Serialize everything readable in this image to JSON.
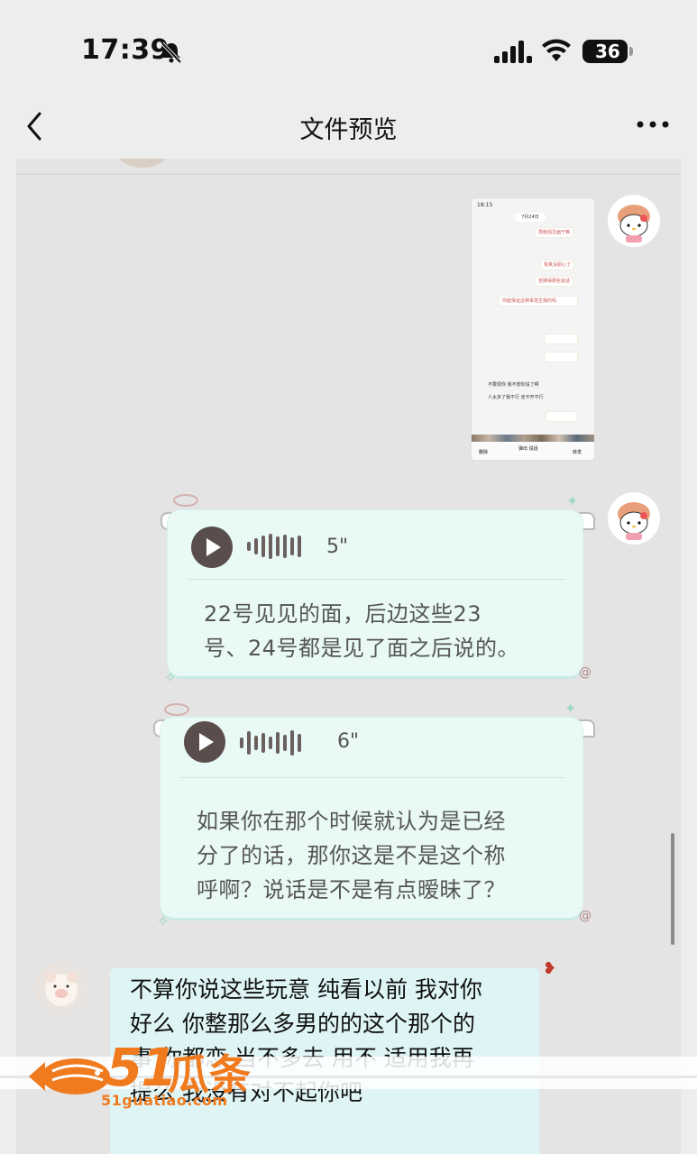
{
  "status_bar": {
    "time": "17:39",
    "battery": "36",
    "icons": [
      "bell-slash-icon",
      "signal-icon",
      "wifi-icon",
      "battery-icon"
    ]
  },
  "nav": {
    "title": "文件预览",
    "back_icon": "chevron-left-icon",
    "more_icon": "more-dots-icon"
  },
  "screenshot_thumbnail": {
    "time": "18:15",
    "date_pill": "7月24日",
    "lines": [
      "再勉强见面干嘛",
      "我真没耐心了",
      "苦撑得那些说话",
      "你能保证这种事发生我的吗",
      "不要烦你 我不想你说了啊",
      "人太多了我不行 走不开不行"
    ],
    "bottom_left": "删除",
    "bottom_center": "弹出 说话",
    "bottom_right": "转发"
  },
  "messages": [
    {
      "type": "voice",
      "duration": "5\"",
      "transcript_line1": "22号见见的面，后边这些23",
      "transcript_line2": "号、24号都是见了面之后说的。"
    },
    {
      "type": "voice",
      "duration": "6\"",
      "transcript_line1": "如果你在那个时候就认为是已经",
      "transcript_line2": "分了的话，那你这是不是这个称",
      "transcript_line3": "呼啊？说话是不是有点暧昧了？"
    },
    {
      "type": "text",
      "line1": "不算你说这些玩意 纯看以前 我对你",
      "line2": "好么 你整那么多男的的这个那个的",
      "line3": "事 你都恋 当不多去 用不 适用我再",
      "line4": "提么 我没有对不起你吧"
    }
  ],
  "watermark": {
    "number": "51",
    "brand": "瓜条",
    "url": "51guatiao.com"
  },
  "colors": {
    "background": "#ededed",
    "voice_card": "#e9faf6",
    "incoming_bubble": "#dff5f5",
    "watermark_orange": "#f07a1e"
  }
}
